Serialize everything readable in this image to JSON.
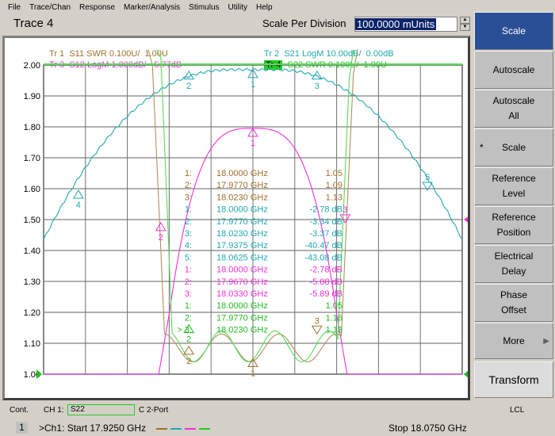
{
  "menu": [
    "File",
    "Trace/Chan",
    "Response",
    "Marker/Analysis",
    "Stimulus",
    "Utility",
    "Help"
  ],
  "toolbar": {
    "active_trace": "Trace 4",
    "scale_label": "Scale Per Division",
    "scale_value": "100.0000 mUnits"
  },
  "traces": [
    {
      "id": "Tr 1",
      "desc": "S11 SWR 0.100U/  1.00U",
      "color": "#a0702a"
    },
    {
      "id": "Tr 2",
      "desc": "S21 LogM 10.00dB/  0.00dB",
      "color": "#20a8b0"
    },
    {
      "id": "Tr 3",
      "desc": "S12 LogM 1.000dB/  -5.77dB",
      "color": "#f030d8"
    },
    {
      "id": "Tr 4",
      "desc": "S22 SWR 0.100U/  1.00U",
      "color": "#30c830",
      "active": true
    }
  ],
  "y_axis": {
    "ticks": [
      "2.00",
      "1.90",
      "1.80",
      "1.70",
      "1.60",
      "1.50",
      "1.40",
      "1.30",
      "1.20",
      "1.10",
      "1.00"
    ],
    "min": 1.0,
    "max": 2.0
  },
  "markers": {
    "tr1": [
      {
        "n": "1:",
        "freq": "18.0000 GHz",
        "val": "1.05"
      },
      {
        "n": "2:",
        "freq": "17.9770 GHz",
        "val": "1.09"
      },
      {
        "n": "3:",
        "freq": "18.0230 GHz",
        "val": "1.13"
      }
    ],
    "tr2": [
      {
        "n": "1:",
        "freq": "18.0000 GHz",
        "val": "-2.78 dB"
      },
      {
        "n": "2:",
        "freq": "17.9770 GHz",
        "val": "-3.34 dB"
      },
      {
        "n": "3:",
        "freq": "18.0230 GHz",
        "val": "-3.37 dB"
      },
      {
        "n": "4:",
        "freq": "17.9375 GHz",
        "val": "-40.47 dB"
      },
      {
        "n": "5:",
        "freq": "18.0625 GHz",
        "val": "-43.08 dB"
      }
    ],
    "tr3": [
      {
        "n": "1:",
        "freq": "18.0000 GHz",
        "val": "-2.78 dB"
      },
      {
        "n": "2:",
        "freq": "17.9670 GHz",
        "val": "-5.88 dB"
      },
      {
        "n": "3:",
        "freq": "18.0330 GHz",
        "val": "-5.89 dB"
      }
    ],
    "tr4": [
      {
        "n": "1:",
        "freq": "18.0000 GHz",
        "val": "1.05"
      },
      {
        "n": "2:",
        "freq": "17.9770 GHz",
        "val": "1.16"
      },
      {
        "n": ">  3:",
        "freq": "18.0230 GHz",
        "val": "1.13"
      }
    ]
  },
  "channel": {
    "number": "1",
    "start": ">Ch1: Start  17.9250 GHz",
    "stop": "Stop  18.0750 GHz"
  },
  "softkeys": [
    {
      "label": "Scale",
      "active": true
    },
    {
      "label": "Autoscale"
    },
    {
      "label": "Autoscale\nAll"
    },
    {
      "label": "Scale",
      "starred": true
    },
    {
      "label": "Reference\nLevel"
    },
    {
      "label": "Reference\nPosition"
    },
    {
      "label": "Electrical\nDelay"
    },
    {
      "label": "Phase\nOffset"
    },
    {
      "label": "More",
      "submenu": true
    },
    {
      "label": "Transform"
    }
  ],
  "status": {
    "mode": "Cont.",
    "channel": "CH 1:",
    "param": "S22",
    "cal": "C  2-Port",
    "remote": "LCL"
  }
}
